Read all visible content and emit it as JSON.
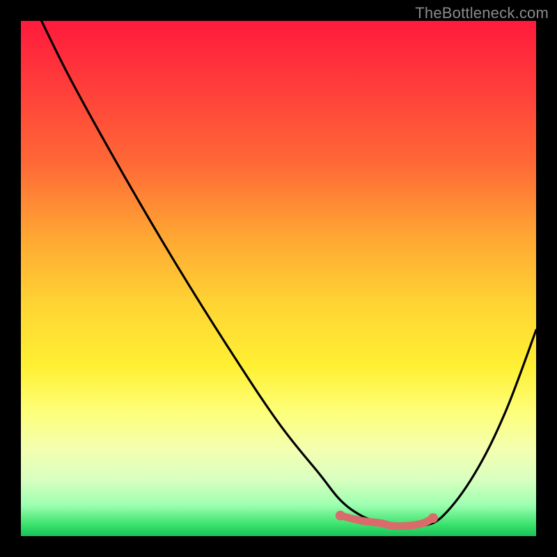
{
  "watermark": "TheBottleneck.com",
  "chart_data": {
    "type": "line",
    "title": "",
    "xlabel": "",
    "ylabel": "",
    "xlim": [
      0,
      100
    ],
    "ylim": [
      0,
      100
    ],
    "series": [
      {
        "name": "bottleneck-curve",
        "x": [
          4,
          10,
          20,
          30,
          40,
          50,
          58,
          62,
          66,
          70,
          72,
          75,
          78,
          82,
          88,
          94,
          100
        ],
        "values": [
          100,
          88,
          70,
          53,
          37,
          22,
          12,
          7,
          4,
          2.5,
          2,
          2,
          2,
          4,
          12,
          24,
          40
        ],
        "color": "#000000"
      },
      {
        "name": "optimal-flat-region",
        "x": [
          62,
          66,
          70,
          72,
          75,
          78,
          80
        ],
        "values": [
          4,
          3,
          2.5,
          2,
          2,
          2.5,
          3.5
        ],
        "color": "#d96b6b"
      }
    ],
    "markers": [
      {
        "name": "optimal-start",
        "x": 62,
        "y": 4,
        "color": "#d96b6b"
      },
      {
        "name": "optimal-end",
        "x": 80,
        "y": 3.5,
        "color": "#d96b6b"
      }
    ]
  }
}
